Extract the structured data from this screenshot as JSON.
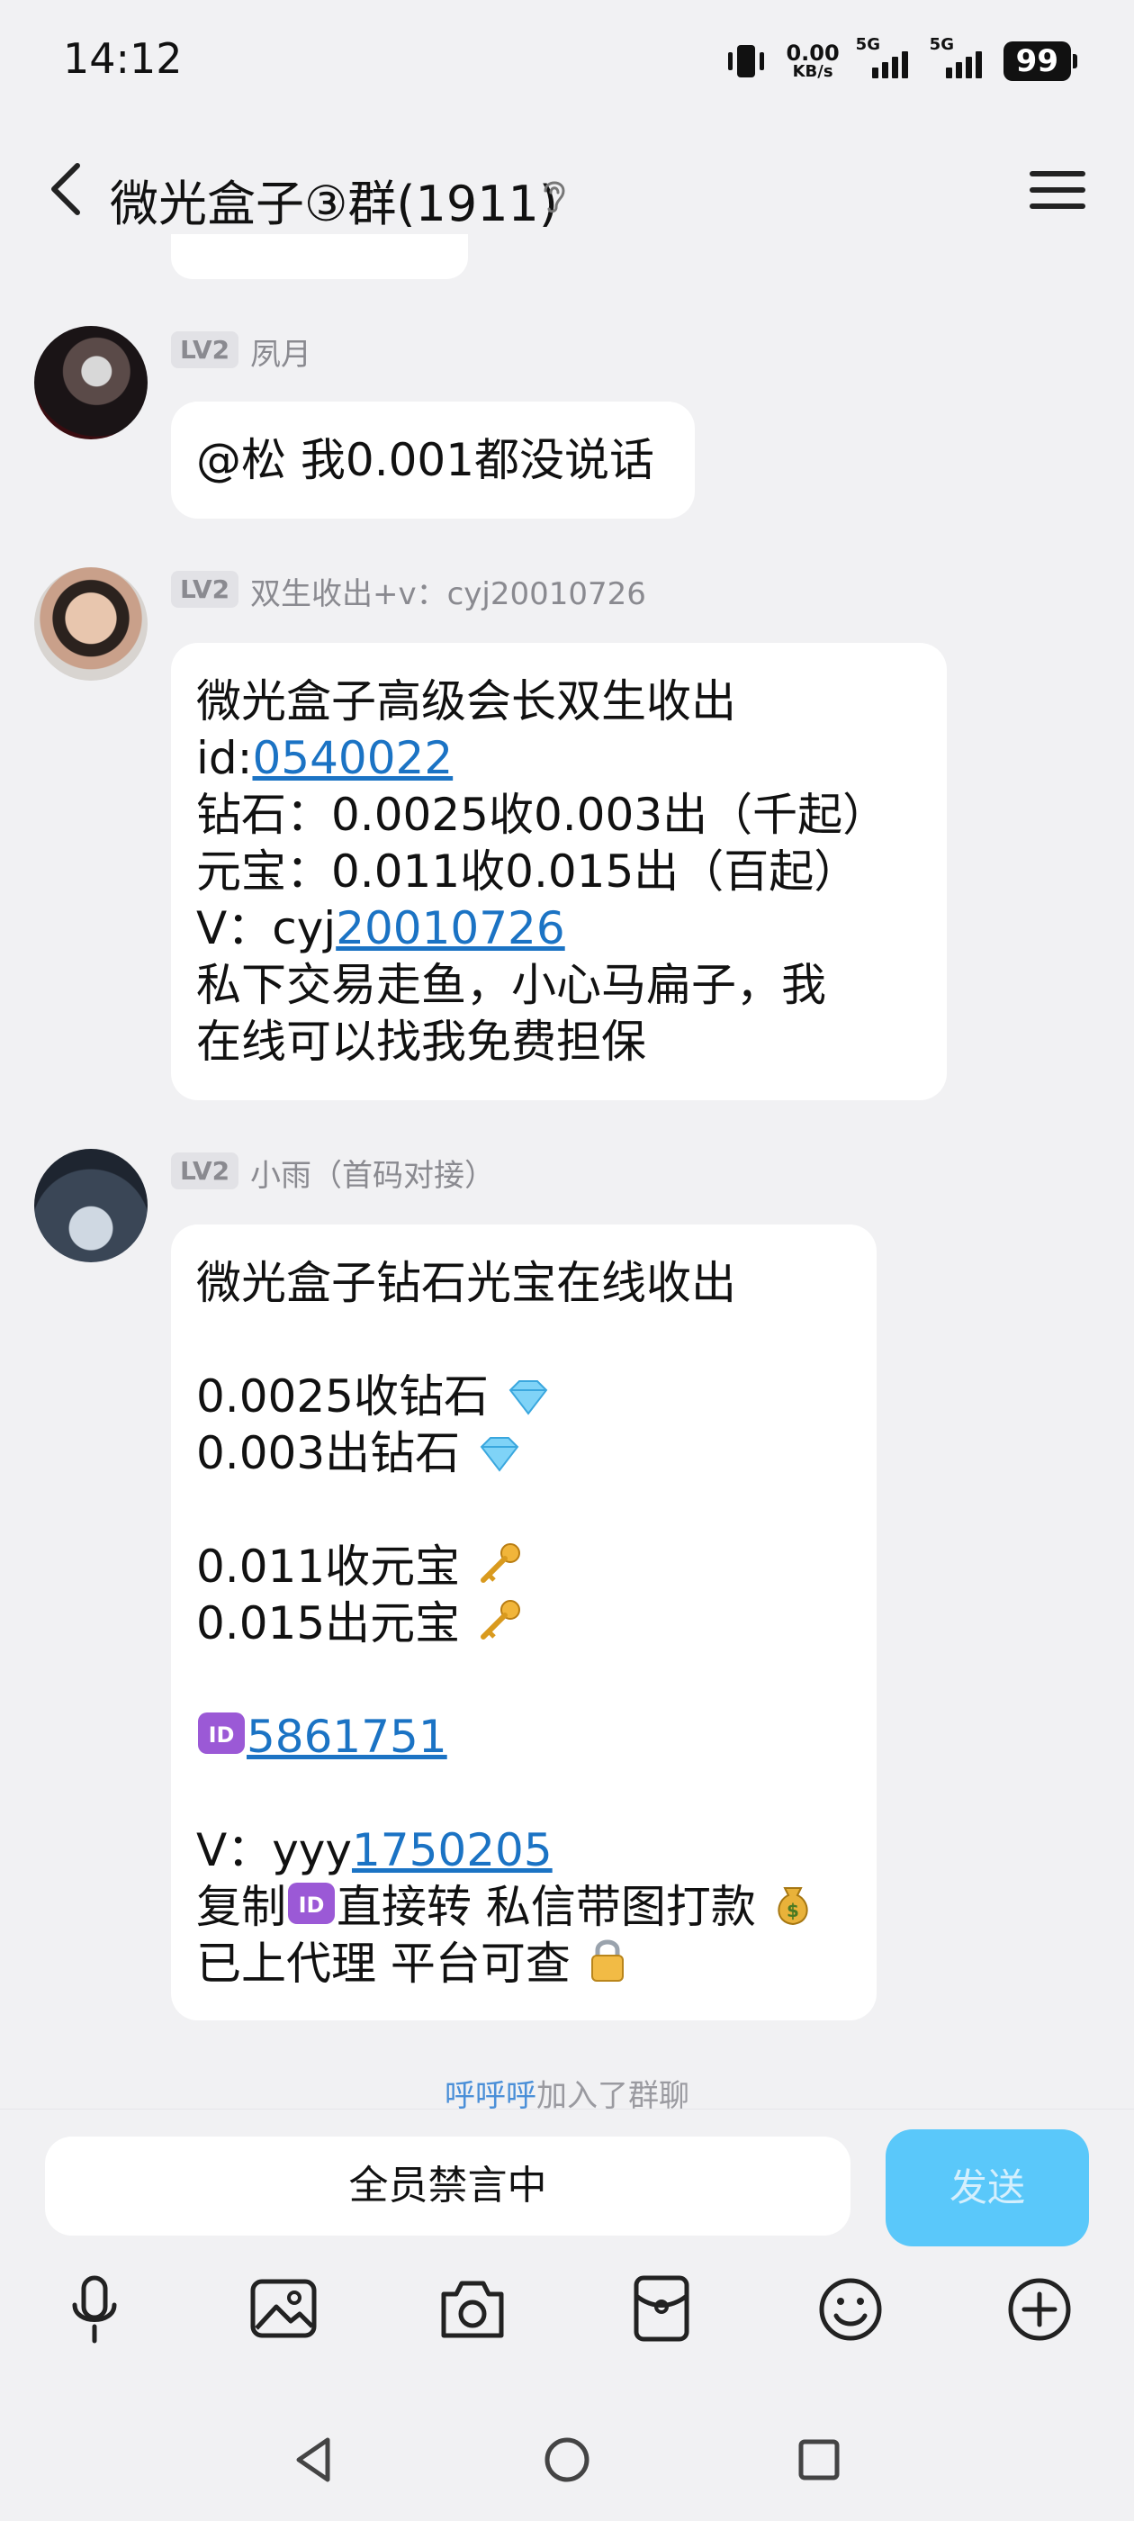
{
  "status_bar": {
    "time": "14:12",
    "net_speed_value": "0.00",
    "net_speed_unit": "KB/s",
    "sim1_label": "5G",
    "sim2_label": "5G",
    "battery": "99"
  },
  "header": {
    "title": "微光盒子③群(1911)"
  },
  "messages": [
    {
      "level": "LV2",
      "name": "夙月",
      "lines": [
        "@松 我0.001都没说话"
      ]
    },
    {
      "level": "LV2",
      "name": "双生收出+v：cyj20010726",
      "line1": "微光盒子高级会长双生收出",
      "line2_prefix": "id:",
      "line2_link": "0540022",
      "line3": "钻石：0.0025收0.003出（千起）",
      "line4": "元宝：0.011收0.015出（百起）",
      "line5_prefix": "V：cyj",
      "line5_link": "20010726",
      "line6": "私下交易走鱼，小心马扁子，我",
      "line7": "在线可以找我免费担保"
    },
    {
      "level": "LV2",
      "name": "小雨（首码对接）",
      "line1": "微光盒子钻石光宝在线收出",
      "line2": "0.0025收钻石",
      "line3": "0.003出钻石",
      "line4": "0.011收元宝",
      "line5": "0.015出元宝",
      "line6_link": "5861751",
      "line7_prefix": "V：yyy",
      "line7_link": "1750205",
      "line8_a": "复制",
      "line8_b": "直接转 私信带图打款",
      "line9": "已上代理 平台可查"
    }
  ],
  "system_notice": {
    "user": "呼呼呼",
    "text": "加入了群聊"
  },
  "input": {
    "placeholder": "全员禁言中",
    "send_label": "发送"
  },
  "toolbar_icons": [
    "microphone-icon",
    "image-icon",
    "camera-icon",
    "red-packet-icon",
    "emoji-icon",
    "plus-icon"
  ],
  "colors": {
    "link": "#1b73c4",
    "send_button": "#5ac8fa",
    "background": "#f1f1f3"
  }
}
